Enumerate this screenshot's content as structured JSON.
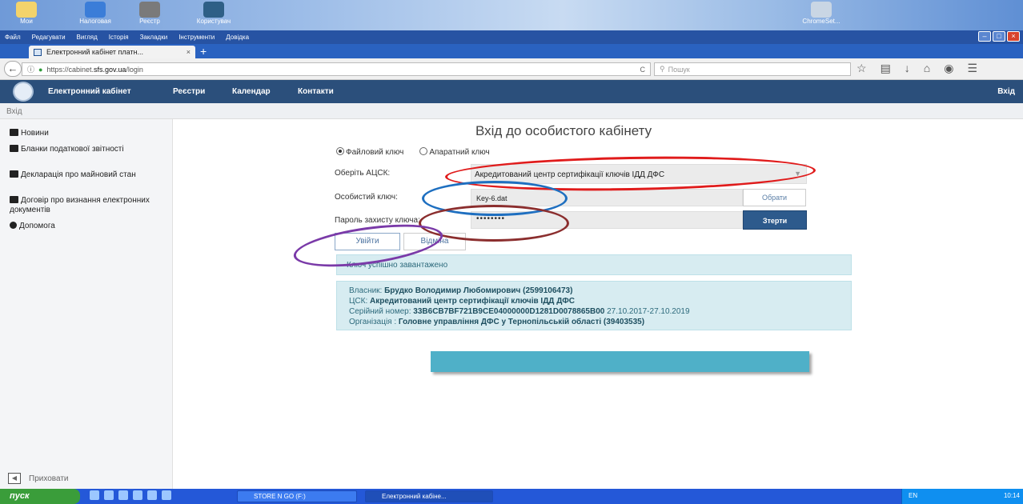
{
  "desktop": {
    "icons": [
      {
        "label": "Мои"
      },
      {
        "label": "Налоговая"
      },
      {
        "label": "Реєстр"
      },
      {
        "label": "Користувач"
      },
      {
        "label": "ChromeSet..."
      }
    ]
  },
  "menubar": {
    "items": [
      "Файл",
      "Редагувати",
      "Вигляд",
      "Історія",
      "Закладки",
      "Інструменти",
      "Довідка"
    ]
  },
  "tab": {
    "title": "Електронний кабінет платн...",
    "close": "×",
    "new": "+"
  },
  "urlbar": {
    "prefix": "https://cabinet.",
    "domain": "sfs.gov.ua",
    "path": "/login",
    "reload": "C"
  },
  "search": {
    "placeholder": "Пошук"
  },
  "site": {
    "name": "Електронний кабінет",
    "nav": [
      "Реєстри",
      "Календар",
      "Контакти"
    ],
    "login": "Вхід",
    "breadcrumb": "Вхід"
  },
  "sidebar": {
    "items": [
      {
        "label": "Новини",
        "icon": "newspaper-icon"
      },
      {
        "label": "Бланки податкової звітності",
        "icon": "file-icon"
      },
      {
        "label": "Декларація про майновий стан",
        "icon": "document-icon"
      },
      {
        "label": "Договір про визнання електронних документів",
        "icon": "contract-icon"
      },
      {
        "label": "Допомога",
        "icon": "help-icon"
      }
    ],
    "hide": "Приховати"
  },
  "form": {
    "title": "Вхід до особистого кабінету",
    "radio_file": "Файловий ключ",
    "radio_hw": "Апаратний ключ",
    "ca_label": "Оберіть АЦСК:",
    "ca_value": "Акредитований центр сертифікації ключів ІДД ДФС",
    "key_label": "Особистий ключ:",
    "key_value": "Key-6.dat",
    "choose": "Обрати",
    "pwd_label": "Пароль захисту ключа:",
    "pwd_value": "••••••••",
    "erase": "Зтерти",
    "login": "Увійти",
    "cancel": "Відміна"
  },
  "status": {
    "success": "Ключ успішно завантажено",
    "owner_label": "Власник:",
    "owner": "Брудко Володимир Любомирович (2599106473)",
    "ca_label": "ЦСК:",
    "ca": "Акредитований центр сертифікації ключів ІДД ДФС",
    "serial_label": "Серійний номер:",
    "serial": "33B6CB7BF721B9CE04000000D1281D0078865B00",
    "validity": "27.10.2017-27.10.2019",
    "org_label": "Організація :",
    "org": "Головне управління ДФС у Тернопільській області (39403535)"
  },
  "taskbar": {
    "start": "пуск",
    "tasks": [
      "STORE N GO (F:)",
      "Електронний кабіне..."
    ],
    "lang": "EN",
    "clock": "10:14"
  },
  "colors": {
    "header": "#2b4f7b",
    "accent": "#2d5a8c",
    "info_bg": "#d7ecf1",
    "annotation_red": "#e01b1b",
    "annotation_blue": "#1e6fc0",
    "annotation_brown": "#8b2e2e",
    "annotation_purple": "#7a3aa8"
  }
}
